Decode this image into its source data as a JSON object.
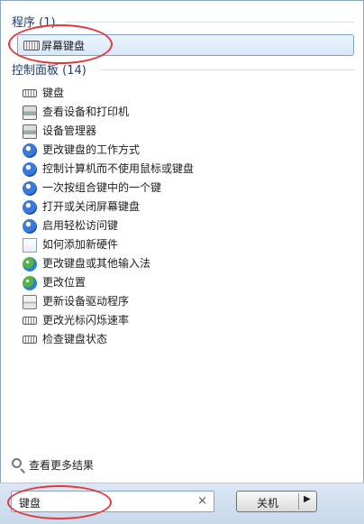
{
  "programs": {
    "header": "程序 (1)",
    "items": [
      {
        "label": "屏幕键盘",
        "icon": "keyboard-icon"
      }
    ]
  },
  "control_panel": {
    "header": "控制面板 (14)",
    "items": [
      {
        "label": "键盘",
        "icon": "keyboard-icon"
      },
      {
        "label": "查看设备和打印机",
        "icon": "printer-icon"
      },
      {
        "label": "设备管理器",
        "icon": "printer-icon"
      },
      {
        "label": "更改键盘的工作方式",
        "icon": "ease-of-access-icon"
      },
      {
        "label": "控制计算机而不使用鼠标或键盘",
        "icon": "ease-of-access-icon"
      },
      {
        "label": "一次按组合键中的一个键",
        "icon": "ease-of-access-icon"
      },
      {
        "label": "打开或关闭屏幕键盘",
        "icon": "ease-of-access-icon"
      },
      {
        "label": "启用轻松访问键",
        "icon": "ease-of-access-icon"
      },
      {
        "label": "如何添加新硬件",
        "icon": "document-icon"
      },
      {
        "label": "更改键盘或其他输入法",
        "icon": "globe-icon"
      },
      {
        "label": "更改位置",
        "icon": "globe-icon"
      },
      {
        "label": "更新设备驱动程序",
        "icon": "device-icon"
      },
      {
        "label": "更改光标闪烁速率",
        "icon": "keyboard-icon"
      },
      {
        "label": "检查键盘状态",
        "icon": "keyboard-icon"
      }
    ]
  },
  "see_more": {
    "label": "查看更多结果",
    "icon": "search-icon"
  },
  "search": {
    "value": "键盘",
    "clear_icon": "close-icon",
    "clear_glyph": "×"
  },
  "shutdown": {
    "label": "关机",
    "arrow_icon": "chevron-right-icon",
    "arrow_glyph": "▶"
  },
  "colors": {
    "accent": "#1e3c78",
    "selection": "#d8e8f9",
    "annotation": "#e03a3a"
  }
}
